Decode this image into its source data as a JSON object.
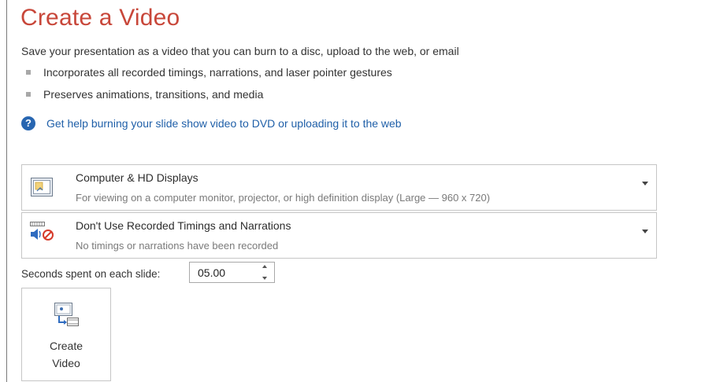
{
  "title": "Create a Video",
  "description": "Save your presentation as a video that you can burn to a disc, upload to the web, or email",
  "bullets": [
    "Incorporates all recorded timings, narrations, and laser pointer gestures",
    "Preserves animations, transitions, and media"
  ],
  "help_link": "Get help burning your slide show video to DVD or uploading it to the web",
  "quality_dropdown": {
    "title": "Computer & HD Displays",
    "subtitle": "For viewing on a computer monitor, projector, or high definition display  (Large — 960 x 720)",
    "icon": "monitor-icon"
  },
  "timing_dropdown": {
    "title": "Don't Use Recorded Timings and Narrations",
    "subtitle": "No timings or narrations have been recorded",
    "icon": "no-narration-icon"
  },
  "seconds": {
    "label": "Seconds spent on each slide:",
    "value": "05.00"
  },
  "create_button": {
    "line1": "Create",
    "line2": "Video",
    "icon": "create-video-icon"
  },
  "colors": {
    "title": "#c8473a",
    "link": "#1f5fa8",
    "help_icon": "#2866b1"
  }
}
